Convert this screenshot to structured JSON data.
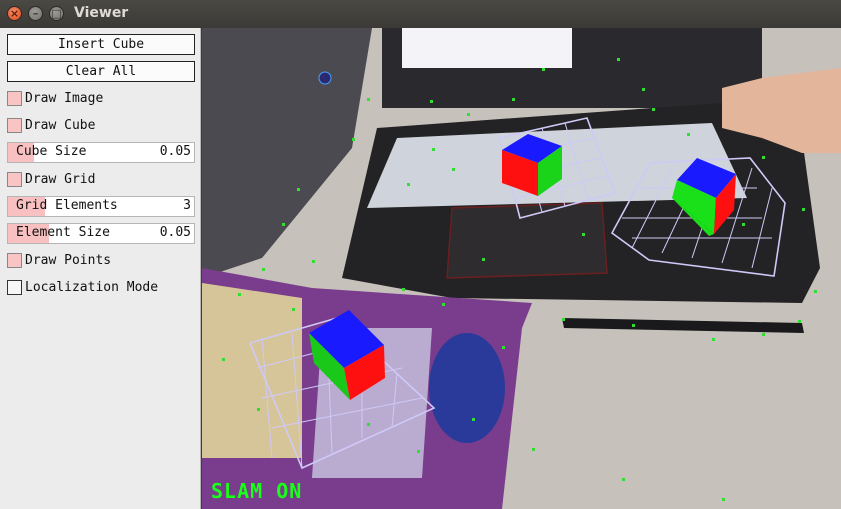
{
  "window": {
    "title": "Viewer"
  },
  "panel": {
    "insert_cube": "Insert Cube",
    "clear_all": "Clear All",
    "draw_image": {
      "label": "Draw Image",
      "checked": true
    },
    "draw_cube": {
      "label": "Draw Cube",
      "checked": true
    },
    "cube_size": {
      "label": "Cube Size",
      "value": "0.05",
      "fill": 0.14
    },
    "draw_grid": {
      "label": "Draw Grid",
      "checked": true
    },
    "grid_elements": {
      "label": "Grid Elements",
      "value": "3",
      "fill": 0.2
    },
    "element_size": {
      "label": "Element Size",
      "value": "0.05",
      "fill": 0.22
    },
    "draw_points": {
      "label": "Draw Points",
      "checked": true
    },
    "localization_mode": {
      "label": "Localization Mode",
      "checked": false
    }
  },
  "viewer": {
    "status": "SLAM ON",
    "colors": {
      "cube_top": "#1a1aff",
      "cube_left": "#19d419",
      "cube_right": "#ff1010",
      "grid": "#c8c4f4",
      "points": "#30e030",
      "status": "#19ff19"
    }
  }
}
